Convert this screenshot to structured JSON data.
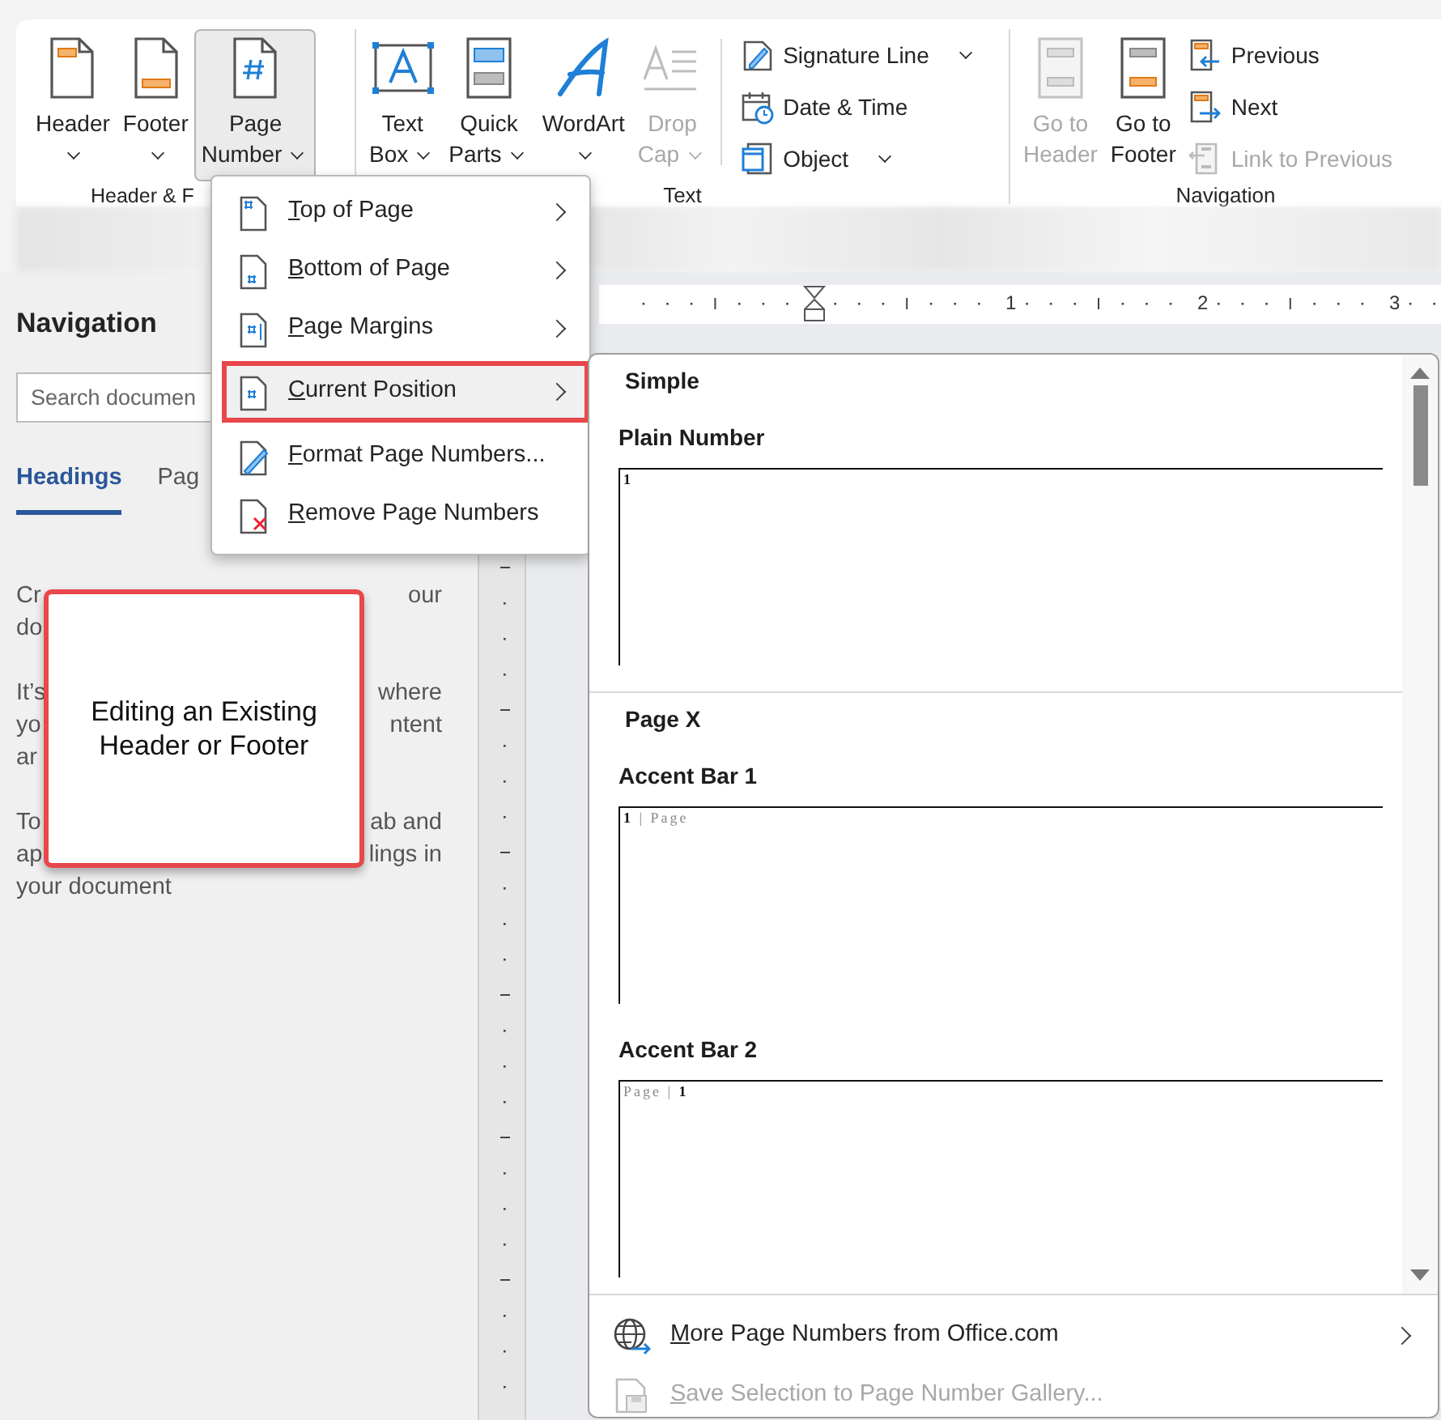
{
  "ribbon": {
    "groups": [
      {
        "label": "Header & F",
        "items": [
          {
            "kind": "large",
            "lines": [
              "Header"
            ],
            "dropdown": true,
            "selected": false,
            "disabled": false
          },
          {
            "kind": "large",
            "lines": [
              "Footer"
            ],
            "dropdown": true,
            "selected": false,
            "disabled": false
          },
          {
            "kind": "large",
            "lines": [
              "Page",
              "Number"
            ],
            "dropdown": true,
            "selected": true,
            "disabled": false
          }
        ]
      },
      {
        "label": "Text",
        "items": [
          {
            "kind": "large",
            "lines": [
              "Text",
              "Box"
            ],
            "dropdown": true,
            "selected": false,
            "disabled": false
          },
          {
            "kind": "large",
            "lines": [
              "Quick",
              "Parts"
            ],
            "dropdown": true,
            "selected": false,
            "disabled": false
          },
          {
            "kind": "large",
            "lines": [
              "WordArt"
            ],
            "dropdown": true,
            "selected": false,
            "disabled": false
          },
          {
            "kind": "large",
            "lines": [
              "Drop",
              "Cap"
            ],
            "dropdown": true,
            "selected": false,
            "disabled": true
          },
          {
            "kind": "small",
            "lines": [
              "Signature Line"
            ],
            "dropdown": true,
            "disabled": false
          },
          {
            "kind": "small",
            "lines": [
              "Date & Time"
            ],
            "dropdown": false,
            "disabled": false
          },
          {
            "kind": "small",
            "lines": [
              "Object"
            ],
            "dropdown": true,
            "disabled": false
          }
        ]
      },
      {
        "label": "Navigation",
        "items": [
          {
            "kind": "large",
            "lines": [
              "Go to",
              "Header"
            ],
            "dropdown": false,
            "selected": false,
            "disabled": true
          },
          {
            "kind": "large",
            "lines": [
              "Go to",
              "Footer"
            ],
            "dropdown": false,
            "selected": false,
            "disabled": false
          },
          {
            "kind": "small",
            "lines": [
              "Previous"
            ],
            "dropdown": false,
            "disabled": false
          },
          {
            "kind": "small",
            "lines": [
              "Next"
            ],
            "dropdown": false,
            "disabled": false
          },
          {
            "kind": "small",
            "lines": [
              "Link to Previous"
            ],
            "dropdown": false,
            "disabled": true
          }
        ]
      }
    ]
  },
  "navigation_pane": {
    "title": "Navigation",
    "search": {
      "placeholder": "Search documen"
    },
    "tabs": [
      {
        "label": "Headings",
        "selected": true
      },
      {
        "label": "Pag",
        "selected": false
      }
    ],
    "paragraphs": [
      {
        "lines": [
          {
            "left": "Cr",
            "right": "our"
          },
          {
            "left": "do"
          }
        ]
      },
      {
        "lines": [
          {
            "left": "It’s",
            "right": "where"
          },
          {
            "left": "yo",
            "right": "ntent"
          },
          {
            "left": "ar"
          }
        ]
      },
      {
        "lines": [
          {
            "left": "To",
            "right": "ab and"
          },
          {
            "left": "ap",
            "right": "lings in"
          },
          {
            "left": "your document"
          }
        ]
      }
    ]
  },
  "ruler": {
    "labels": [
      "1",
      "2",
      "3"
    ]
  },
  "page_number_menu": {
    "items": [
      {
        "label": "Top of Page",
        "submenu": true,
        "selected": false
      },
      {
        "label": "Bottom of Page",
        "submenu": true,
        "selected": false
      },
      {
        "label": "Page Margins",
        "submenu": true,
        "selected": false
      },
      {
        "label": "Current Position",
        "submenu": true,
        "selected": true
      },
      {
        "label": "Format Page Numbers...",
        "submenu": false,
        "selected": false
      },
      {
        "label": "Remove Page Numbers",
        "submenu": false,
        "selected": false
      }
    ]
  },
  "gallery": {
    "sections": [
      {
        "title": "Simple",
        "items": [
          {
            "name": "Plain Number",
            "preview": "**1**"
          }
        ]
      },
      {
        "title": "Page X",
        "items": [
          {
            "name": "Accent Bar 1",
            "preview": "**1** | Page"
          },
          {
            "name": "Accent Bar 2",
            "preview": "Page | **1**"
          }
        ]
      }
    ],
    "footer": [
      {
        "label": "More Page Numbers from Office.com",
        "submenu": true,
        "disabled": false
      },
      {
        "label": "Save Selection to Page Number Gallery...",
        "submenu": false,
        "disabled": true
      }
    ]
  },
  "callout": {
    "text": "Editing an Existing Header or Footer"
  }
}
